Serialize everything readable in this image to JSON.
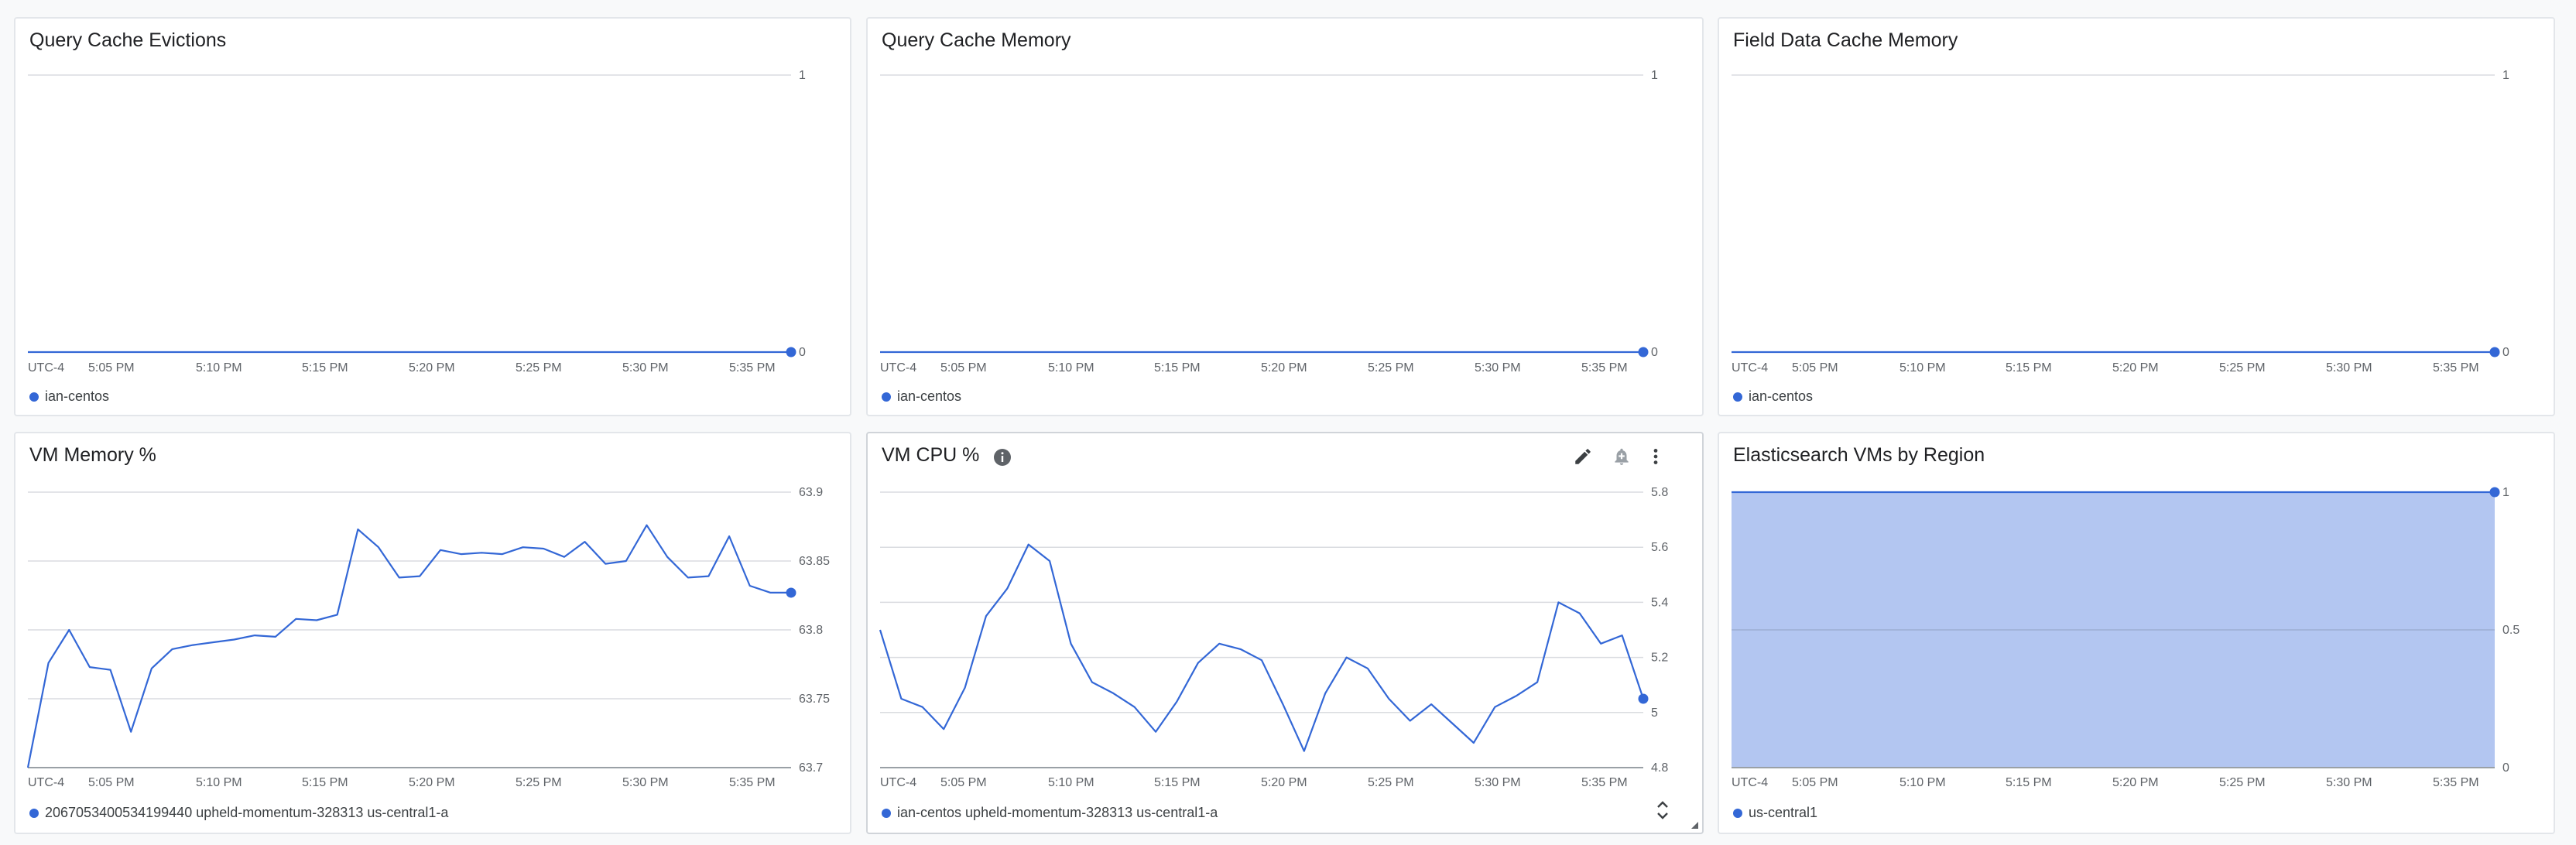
{
  "accent_color": "#3367d6",
  "area_fill": "#b3c6f1",
  "x_ticks": [
    "UTC-4",
    "5:05 PM",
    "5:10 PM",
    "5:15 PM",
    "5:20 PM",
    "5:25 PM",
    "5:30 PM",
    "5:35 PM"
  ],
  "charts": [
    {
      "id": "query-cache-evictions",
      "title": "Query Cache Evictions",
      "legend": "ian-centos",
      "chart_data": {
        "type": "line",
        "title": "Query Cache Evictions",
        "y_ticks": [
          "1",
          "0"
        ],
        "ylim": [
          0,
          1
        ],
        "x_tick_labels": [
          "UTC-4",
          "5:05 PM",
          "5:10 PM",
          "5:15 PM",
          "5:20 PM",
          "5:25 PM",
          "5:30 PM",
          "5:35 PM"
        ],
        "series": [
          {
            "name": "ian-centos",
            "values": [
              0,
              0
            ]
          }
        ],
        "grid": true
      }
    },
    {
      "id": "query-cache-memory",
      "title": "Query Cache Memory",
      "legend": "ian-centos",
      "chart_data": {
        "type": "line",
        "title": "Query Cache Memory",
        "y_ticks": [
          "1",
          "0"
        ],
        "ylim": [
          0,
          1
        ],
        "x_tick_labels": [
          "UTC-4",
          "5:05 PM",
          "5:10 PM",
          "5:15 PM",
          "5:20 PM",
          "5:25 PM",
          "5:30 PM",
          "5:35 PM"
        ],
        "series": [
          {
            "name": "ian-centos",
            "values": [
              0,
              0
            ]
          }
        ],
        "grid": true
      }
    },
    {
      "id": "field-data-cache-memory",
      "title": "Field Data Cache Memory",
      "legend": "ian-centos",
      "chart_data": {
        "type": "line",
        "title": "Field Data Cache Memory",
        "y_ticks": [
          "1",
          "0"
        ],
        "ylim": [
          0,
          1
        ],
        "x_tick_labels": [
          "UTC-4",
          "5:05 PM",
          "5:10 PM",
          "5:15 PM",
          "5:20 PM",
          "5:25 PM",
          "5:30 PM",
          "5:35 PM"
        ],
        "series": [
          {
            "name": "ian-centos",
            "values": [
              0,
              0
            ]
          }
        ],
        "grid": true
      }
    },
    {
      "id": "vm-memory",
      "title": "VM Memory %",
      "legend": "2067053400534199440 upheld-momentum-328313 us-central1-a",
      "chart_data": {
        "type": "line",
        "title": "VM Memory %",
        "y_ticks": [
          "63.9",
          "63.85",
          "63.8",
          "63.75",
          "63.7"
        ],
        "ylim": [
          63.7,
          63.9
        ],
        "x_tick_labels": [
          "UTC-4",
          "5:05 PM",
          "5:10 PM",
          "5:15 PM",
          "5:20 PM",
          "5:25 PM",
          "5:30 PM",
          "5:35 PM"
        ],
        "series": [
          {
            "name": "2067053400534199440 upheld-momentum-328313 us-central1-a",
            "values": [
              63.7,
              63.776,
              63.8,
              63.773,
              63.771,
              63.726,
              63.772,
              63.786,
              63.789,
              63.791,
              63.793,
              63.796,
              63.795,
              63.808,
              63.807,
              63.811,
              63.873,
              63.86,
              63.838,
              63.839,
              63.858,
              63.855,
              63.856,
              63.855,
              63.86,
              63.859,
              63.853,
              63.864,
              63.848,
              63.85,
              63.876,
              63.853,
              63.838,
              63.839,
              63.868,
              63.832,
              63.827,
              63.827
            ]
          }
        ],
        "grid": true
      }
    },
    {
      "id": "vm-cpu",
      "title": "VM CPU %",
      "legend": "ian-centos upheld-momentum-328313 us-central1-a",
      "chart_data": {
        "type": "line",
        "title": "VM CPU %",
        "y_ticks": [
          "5.8",
          "5.6",
          "5.4",
          "5.2",
          "5",
          "4.8"
        ],
        "ylim": [
          4.8,
          5.8
        ],
        "x_tick_labels": [
          "UTC-4",
          "5:05 PM",
          "5:10 PM",
          "5:15 PM",
          "5:20 PM",
          "5:25 PM",
          "5:30 PM",
          "5:35 PM"
        ],
        "series": [
          {
            "name": "ian-centos upheld-momentum-328313 us-central1-a",
            "values": [
              5.3,
              5.05,
              5.02,
              4.94,
              5.09,
              5.35,
              5.45,
              5.61,
              5.55,
              5.25,
              5.11,
              5.07,
              5.02,
              4.93,
              5.04,
              5.18,
              5.25,
              5.23,
              5.19,
              5.03,
              4.86,
              5.07,
              5.2,
              5.16,
              5.05,
              4.97,
              5.03,
              4.96,
              4.89,
              5.02,
              5.06,
              5.11,
              5.4,
              5.36,
              5.25,
              5.28,
              5.05
            ]
          }
        ],
        "grid": true
      }
    },
    {
      "id": "elasticsearch-vms-by-region",
      "title": "Elasticsearch VMs by Region",
      "legend": "us-central1",
      "chart_data": {
        "type": "area",
        "title": "Elasticsearch VMs by Region",
        "y_ticks": [
          "1",
          "0.5",
          "0"
        ],
        "ylim": [
          0,
          1
        ],
        "x_tick_labels": [
          "UTC-4",
          "5:05 PM",
          "5:10 PM",
          "5:15 PM",
          "5:20 PM",
          "5:25 PM",
          "5:30 PM",
          "5:35 PM"
        ],
        "series": [
          {
            "name": "us-central1",
            "values": [
              1,
              1
            ]
          }
        ],
        "grid": true
      }
    }
  ],
  "toolbar": {
    "edit_icon": "pencil-icon",
    "alert_icon": "bell-plus-icon",
    "menu_icon": "more-vert-icon",
    "expand_icon": "unfold-icon"
  }
}
